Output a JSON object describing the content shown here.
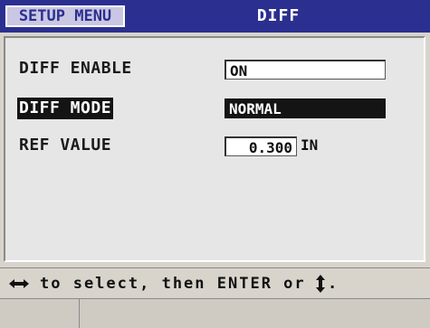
{
  "header": {
    "menu_label": "SETUP MENU",
    "title": "DIFF"
  },
  "settings": [
    {
      "label": "DIFF ENABLE",
      "value": "ON"
    },
    {
      "label": "DIFF MODE",
      "value": "NORMAL"
    },
    {
      "label": "REF VALUE",
      "value": "0.300",
      "unit": "IN"
    }
  ],
  "hint": {
    "left_icon": "left-right-arrow-icon",
    "text": "to select, then ENTER or",
    "right_icon": "up-down-arrow-icon",
    "end": "."
  },
  "colors": {
    "title_bar": "#2b2f8f",
    "selection": "#141414"
  }
}
